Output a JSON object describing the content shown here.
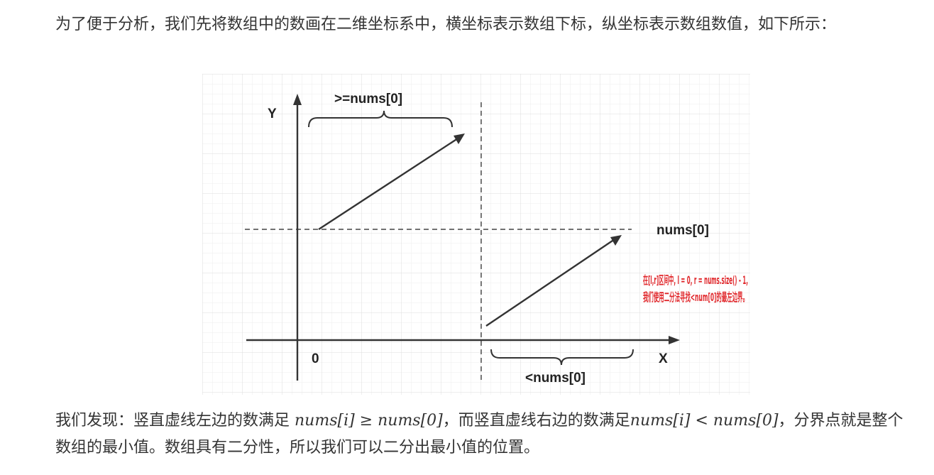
{
  "intro_text": "为了便于分析，我们先将数组中的数画在二维坐标系中，横坐标表示数组下标，纵坐标表示数组数值，如下所示：",
  "diagram": {
    "y_axis_label": "Y",
    "x_axis_label": "X",
    "origin_label": "0",
    "left_brace_label": ">=nums[0]",
    "right_brace_label": "<nums[0]",
    "horizontal_line_label": "nums[0]",
    "note_line1": "在[l,r]区间中, l = 0, r = nums.size() - 1,",
    "note_line2": "我们使用二分法寻找<num[0]的最左边界。",
    "note_color": "#e0262a"
  },
  "conclusion": {
    "part1": "我们发现：竖直虚线左边的数满足 ",
    "math1": "nums[i] ≥ nums[0]",
    "part2": "，而竖直虚线右边的数满足",
    "math2": "nums[i] < nums[0]",
    "part3": "，分界点就是整个数组的最小值。数组具有二分性，所以我们可以二分出最小值的位置。"
  }
}
